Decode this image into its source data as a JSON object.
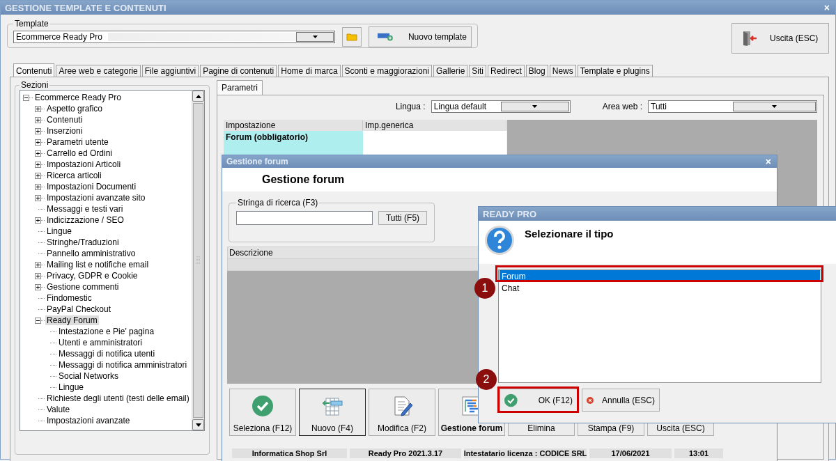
{
  "window": {
    "title": "GESTIONE TEMPLATE E CONTENUTI",
    "close_button": "×"
  },
  "template": {
    "legend": "Template",
    "value": "Ecommerce Ready Pro",
    "new_button": "Nuovo template"
  },
  "exit_button": "Uscita (ESC)",
  "tabs": [
    {
      "label": "Contenuti",
      "selected": true
    },
    {
      "label": "Aree web e categorie",
      "selected": false
    },
    {
      "label": "File aggiuntivi",
      "selected": false
    },
    {
      "label": "Pagine di contenuti",
      "selected": false
    },
    {
      "label": "Home di marca",
      "selected": false
    },
    {
      "label": "Sconti e maggiorazioni",
      "selected": false
    },
    {
      "label": "Gallerie",
      "selected": false
    },
    {
      "label": "Siti",
      "selected": false
    },
    {
      "label": "Redirect",
      "selected": false
    },
    {
      "label": "Blog",
      "selected": false
    },
    {
      "label": "News",
      "selected": false
    },
    {
      "label": "Template e plugins",
      "selected": false
    }
  ],
  "sections": {
    "legend": "Sezioni",
    "tree": [
      {
        "label": "Ecommerce Ready Pro",
        "kind": "group",
        "expanded": true,
        "selected": false,
        "children": [
          {
            "label": "Aspetto grafico",
            "kind": "group",
            "expanded": false,
            "selected": false
          },
          {
            "label": "Contenuti",
            "kind": "group",
            "expanded": false,
            "selected": false
          },
          {
            "label": "Inserzioni",
            "kind": "group",
            "expanded": false,
            "selected": false
          },
          {
            "label": "Parametri utente",
            "kind": "group",
            "expanded": false,
            "selected": false
          },
          {
            "label": "Carrello ed Ordini",
            "kind": "group",
            "expanded": false,
            "selected": false
          },
          {
            "label": "Impostazioni Articoli",
            "kind": "group",
            "expanded": false,
            "selected": false
          },
          {
            "label": "Ricerca articoli",
            "kind": "group",
            "expanded": false,
            "selected": false
          },
          {
            "label": "Impostazioni Documenti",
            "kind": "group",
            "expanded": false,
            "selected": false
          },
          {
            "label": "Impostazioni avanzate sito",
            "kind": "group",
            "expanded": false,
            "selected": false
          },
          {
            "label": "Messaggi e testi vari",
            "kind": "leaf",
            "selected": false
          },
          {
            "label": "Indicizzazione / SEO",
            "kind": "group",
            "expanded": false,
            "selected": false
          },
          {
            "label": "Lingue",
            "kind": "leaf",
            "selected": false
          },
          {
            "label": "Stringhe/Traduzioni",
            "kind": "leaf",
            "selected": false
          },
          {
            "label": "Pannello amministrativo",
            "kind": "leaf",
            "selected": false
          },
          {
            "label": "Mailing list e notifiche email",
            "kind": "group",
            "expanded": false,
            "selected": false
          },
          {
            "label": "Privacy, GDPR e Cookie",
            "kind": "group",
            "expanded": false,
            "selected": false
          },
          {
            "label": "Gestione commenti",
            "kind": "group",
            "expanded": false,
            "selected": false
          },
          {
            "label": "Findomestic",
            "kind": "leaf",
            "selected": false
          },
          {
            "label": "PayPal Checkout",
            "kind": "leaf",
            "selected": false
          },
          {
            "label": "Ready Forum",
            "kind": "group",
            "expanded": true,
            "selected": true,
            "children": [
              {
                "label": "Intestazione e Pie' pagina",
                "kind": "leaf",
                "selected": false
              },
              {
                "label": "Utenti e amministratori",
                "kind": "leaf",
                "selected": false
              },
              {
                "label": "Messaggi di notifica utenti",
                "kind": "leaf",
                "selected": false
              },
              {
                "label": "Messaggi di notifica amministratori",
                "kind": "leaf",
                "selected": false
              },
              {
                "label": "Social Networks",
                "kind": "leaf",
                "selected": false
              },
              {
                "label": "Lingue",
                "kind": "leaf",
                "selected": false
              }
            ]
          },
          {
            "label": "Richieste degli utenti (testi delle email)",
            "kind": "leaf",
            "selected": false
          },
          {
            "label": "Valute",
            "kind": "leaf",
            "selected": false
          },
          {
            "label": "Impostazioni avanzate",
            "kind": "leaf",
            "selected": false
          }
        ]
      }
    ]
  },
  "parameters": {
    "tab": "Parametri",
    "language_label": "Lingua :",
    "language": "Lingua default",
    "area_label": "Area web :",
    "area": "Tutti",
    "columns": [
      "Impostazione",
      "Imp.generica"
    ],
    "rows": [
      {
        "setting": "Forum (obbligatorio)",
        "selected": true
      }
    ]
  },
  "forum_window": {
    "title": "Gestione forum",
    "close_button": "×",
    "heading": "Gestione forum",
    "search": {
      "legend": "Stringa di ricerca (F3)",
      "button": "Tutti (F5)"
    },
    "grid_columns": [
      "Descrizione"
    ],
    "buttons": [
      {
        "label": "Seleziona (F12)",
        "kind": "check",
        "focused": false,
        "active": false
      },
      {
        "label": "Nuovo (F4)",
        "kind": "new",
        "focused": true,
        "active": false
      },
      {
        "label": "Modifica (F2)",
        "kind": "edit",
        "focused": false,
        "active": false
      },
      {
        "label": "Gestione forum",
        "kind": "tree",
        "focused": false,
        "active": true
      },
      {
        "label": "Elimina",
        "kind": "none",
        "focused": false,
        "active": false
      },
      {
        "label": "Stampa (F9)",
        "kind": "none",
        "focused": false,
        "active": false
      },
      {
        "label": "Uscita (ESC)",
        "kind": "none",
        "focused": false,
        "active": false
      }
    ],
    "status_bar": [
      "Informatica Shop Srl",
      "Ready Pro 2021.3.17",
      "Intestatario licenza : CODICE SRL",
      "17/06/2021",
      "13:01"
    ]
  },
  "dialog": {
    "title": "READY PRO",
    "message": "Selezionare il tipo",
    "options": [
      {
        "label": "Forum",
        "selected": true
      },
      {
        "label": "Chat",
        "selected": false
      }
    ],
    "ok_button": "OK (F12)",
    "cancel_button": "Annulla (ESC)",
    "markers": [
      "1",
      "2"
    ]
  }
}
